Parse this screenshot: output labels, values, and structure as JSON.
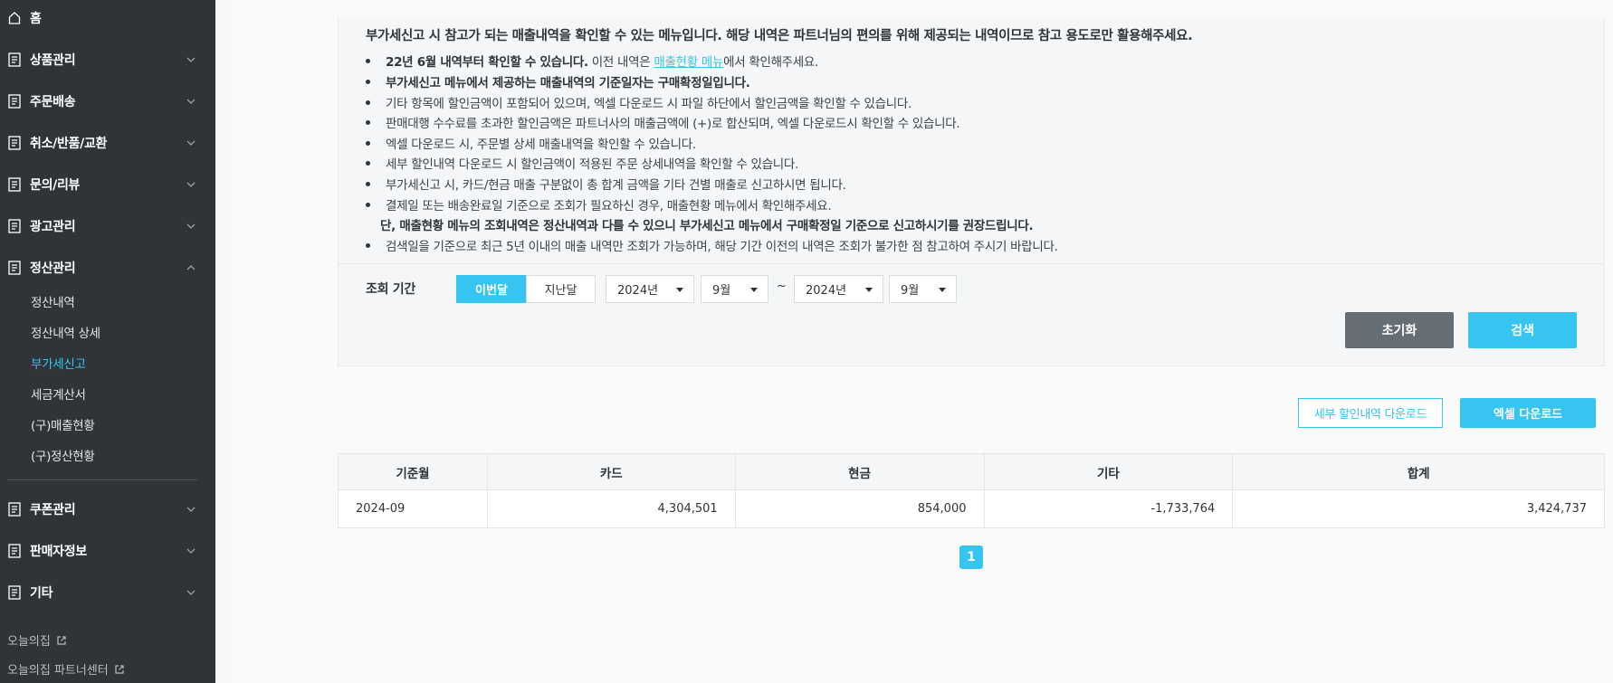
{
  "colors": {
    "sidebar_bg": "#2f3438",
    "accent": "#35c5f0",
    "reset_button": "#656e75"
  },
  "sidebar": {
    "home": {
      "label": "홈",
      "icon": "home-icon"
    },
    "menus": [
      {
        "label": "상품관리",
        "icon": "document-icon",
        "expanded": false
      },
      {
        "label": "주문배송",
        "icon": "document-icon",
        "expanded": false
      },
      {
        "label": "취소/반품/교환",
        "icon": "document-icon",
        "expanded": false
      },
      {
        "label": "문의/리뷰",
        "icon": "document-icon",
        "expanded": false
      },
      {
        "label": "광고관리",
        "icon": "document-icon",
        "expanded": false
      },
      {
        "label": "정산관리",
        "icon": "document-icon",
        "expanded": true
      }
    ],
    "settlement_sub": [
      "정산내역",
      "정산내역 상세",
      "부가세신고",
      "세금계산서",
      "(구)매출현황",
      "(구)정산현황"
    ],
    "active_sub": "부가세신고",
    "menus_bottom": [
      {
        "label": "쿠폰관리",
        "icon": "document-icon",
        "expanded": false
      },
      {
        "label": "판매자정보",
        "icon": "document-icon",
        "expanded": false
      },
      {
        "label": "기타",
        "icon": "document-icon",
        "expanded": false
      }
    ],
    "footer_links": [
      {
        "label": "오늘의집",
        "icon": "external-link-icon"
      },
      {
        "label": "오늘의집 파트너센터",
        "icon": "external-link-icon"
      }
    ]
  },
  "notice": {
    "title": "부가세신고 시 참고가 되는 매출내역을 확인할 수 있는 메뉴입니다. 해당 내역은 파트너님의 편의를 위해 제공되는 내역이므로 참고 용도로만 활용해주세요.",
    "b1_bold": "22년 6월 내역부터 확인할 수 있습니다.",
    "b1_pre": " 이전 내역은 ",
    "b1_link": "매출현황 메뉴",
    "b1_post": "에서 확인해주세요.",
    "b2": "부가세신고 메뉴에서 제공하는 매출내역의 기준일자는 구매확정일입니다.",
    "b3": "기타 항목에 할인금액이 포함되어 있으며, 엑셀 다운로드 시 파일 하단에서 할인금액을 확인할 수 있습니다.",
    "b4": "판매대행 수수료를 초과한 할인금액은 파트너사의 매출금액에 (+)로 합산되며, 엑셀 다운로드시 확인할 수 있습니다.",
    "b5": "엑셀 다운로드 시, 주문별 상세 매출내역을 확인할 수 있습니다.",
    "b6": "세부 할인내역 다운로드 시 할인금액이 적용된 주문 상세내역을 확인할 수 있습니다.",
    "b7": "부가세신고 시, 카드/현금 매출 구분없이 총 합계 금액을 기타 건별 매출로 신고하시면 됩니다.",
    "b8": "결제일 또는 배송완료일 기준으로 조회가 필요하신 경우, 매출현황 메뉴에서 확인해주세요.",
    "note": "단, 매출현황 메뉴의 조회내역은 정산내역과 다를 수 있으니 부가세신고 메뉴에서 구매확정일 기준으로 신고하시기를 권장드립니다.",
    "b9": "검색일을 기준으로 최근 5년 이내의 매출 내역만 조회가 가능하며, 해당 기간 이전의 내역은 조회가 불가한 점 참고하여 주시기 바랍니다."
  },
  "search": {
    "period_label": "조회 기간",
    "tab_this_month": "이번달",
    "tab_last_month": "지난달",
    "from_year": "2024년",
    "from_month": "9월",
    "separator": "~",
    "to_year": "2024년",
    "to_month": "9월",
    "reset_label": "초기화",
    "search_label": "검색"
  },
  "actions": {
    "discount_download": "세부 할인내역 다운로드",
    "excel_download": "엑셀 다운로드"
  },
  "table": {
    "headers": [
      "기준월",
      "카드",
      "현금",
      "기타",
      "합계"
    ],
    "rows": [
      [
        "2024-09",
        "4,304,501",
        "854,000",
        "-1,733,764",
        "3,424,737"
      ]
    ]
  },
  "pagination": {
    "current_page": "1"
  }
}
